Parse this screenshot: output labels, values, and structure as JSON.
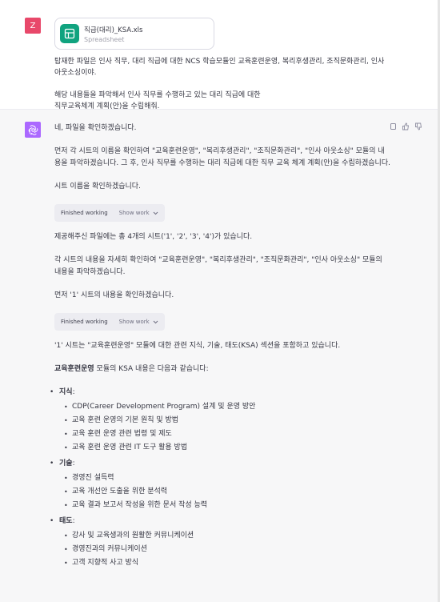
{
  "user": {
    "avatar_letter": "Z",
    "file": {
      "name": "직급(대리)_KSA.xls",
      "type": "Spreadsheet"
    },
    "message_p1": "탑재한 파일은 인사 직무, 대리 직급에 대한 NCS 학습모듈인 교육훈련운영, 복리후생관리, 조직문화관리, 인사 아웃소싱이야.",
    "message_p2_line1": "해당 내용들을 파악해서 인사 직무를 수행하고 있는 대리 직급에 대한",
    "message_p2_line2": "직무교육체계 계획(안)을 수립해줘."
  },
  "assistant": {
    "p1": "네, 파일을 확인하겠습니다.",
    "p2": "먼저 각 시트의 이름을 확인하여 \"교육훈련운영\", \"복리후생관리\", \"조직문화관리\", \"인사 아웃소싱\" 모듈의 내용을 파악하겠습니다. 그 후, 인사 직무를 수행하는 대리 직급에 대한 직무 교육 체계 계획(안)을 수립하겠습니다.",
    "p3": "시트 이름을 확인하겠습니다.",
    "work1": {
      "label": "Finished working",
      "show": "Show work"
    },
    "p4": "제공해주신 파일에는 총 4개의 시트('1', '2', '3', '4')가 있습니다.",
    "p5": "각 시트의 내용을 자세히 확인하여 \"교육훈련운영\", \"복리후생관리\", \"조직문화관리\", \"인사 아웃소싱\" 모듈의 내용을 파악하겠습니다.",
    "p6": "먼저 '1' 시트의 내용을 확인하겠습니다.",
    "work2": {
      "label": "Finished working",
      "show": "Show work"
    },
    "p7": "'1' 시트는 \"교육훈련운영\" 모듈에 대한 관련 지식, 기술, 태도(KSA) 섹션을 포함하고 있습니다.",
    "p8_bold": "교육훈련운영",
    "p8_rest": " 모듈의 KSA 내용은 다음과 같습니다:",
    "knowledge": {
      "title": "지식",
      "items": [
        "CDP(Career Development Program) 설계 및 운영 방안",
        "교육 훈련 운영의 기본 원칙 및 방법",
        "교육 훈련 운영 관련 법령 및 제도",
        "교육 훈련 운영 관련 IT 도구 활용 방법"
      ]
    },
    "skill": {
      "title": "기술",
      "items": [
        "경영진 설득력",
        "교육 개선안 도출을 위한 분석력",
        "교육 결과 보고서 작성을 위한 문서 작성 능력"
      ]
    },
    "attitude": {
      "title": "태도",
      "items": [
        "강사 및 교육생과의 원활한 커뮤니케이션",
        "경영진과의 커뮤니케이션",
        "고객 지향적 사고 방식"
      ]
    }
  }
}
